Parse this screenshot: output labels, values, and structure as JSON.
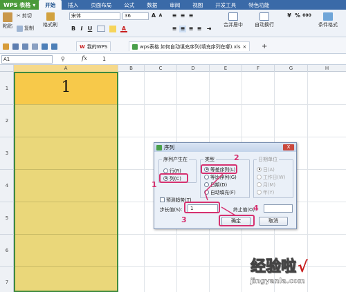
{
  "menubar": {
    "app_name": "WPS 表格",
    "tabs": [
      "开始",
      "插入",
      "页面布局",
      "公式",
      "数据",
      "审阅",
      "视图",
      "开发工具",
      "特色功能"
    ]
  },
  "ribbon": {
    "paste": "粘贴",
    "cut": "剪切",
    "copy": "复制",
    "format_painter": "格式刷",
    "font_name": "宋体",
    "font_size": "36",
    "bold": "B",
    "italic": "I",
    "underline": "U",
    "font_color": "A",
    "merge_center": "合并居中",
    "auto_wrap": "自动换行",
    "conditional_format": "条件格式",
    "currency_symbol": "¥",
    "percent_symbol": "%",
    "comma_symbol": "000"
  },
  "tabstrip": {
    "tabs": [
      "我的WPS",
      "wps表格 如何自动填充序列(填充序列在哪).xls"
    ],
    "new_tab": "+",
    "close_icon": "×"
  },
  "formula_bar": {
    "cell_ref": "A1",
    "fx": "fx",
    "value": "1"
  },
  "grid": {
    "columns": [
      "A",
      "B",
      "C",
      "D",
      "E",
      "F",
      "G",
      "H"
    ],
    "rows": [
      "1",
      "2",
      "3",
      "4",
      "5",
      "6",
      "7"
    ],
    "a1_value": "1"
  },
  "dialog": {
    "title": "序列",
    "close": "X",
    "series_in_legend": "序列产生在",
    "series_in_row": "行(R)",
    "series_in_col": "列(C)",
    "type_legend": "类型",
    "type_linear": "等差序列(L)",
    "type_growth": "等比序列(G)",
    "type_date": "日期(D)",
    "type_autofill": "自动填充(F)",
    "date_unit_legend": "日期单位",
    "date_day": "日(A)",
    "date_weekday": "工作日(W)",
    "date_month": "月(M)",
    "date_year": "年(Y)",
    "trend": "预测趋势(T)",
    "step_label": "步长值(S):",
    "step_value": "1",
    "stop_label": "终止值(O):",
    "stop_value": "",
    "ok": "确定",
    "cancel": "取消"
  },
  "annotations": [
    "1",
    "2",
    "3",
    "4"
  ],
  "watermark": {
    "line1": "经验啦",
    "check": "√",
    "line2": "jingyanla.com"
  },
  "colors": {
    "menu_blue": "#3a6aa8",
    "cell_a1": "#f7c94a",
    "column_a": "#ead77a",
    "annotation": "#d6306f"
  }
}
